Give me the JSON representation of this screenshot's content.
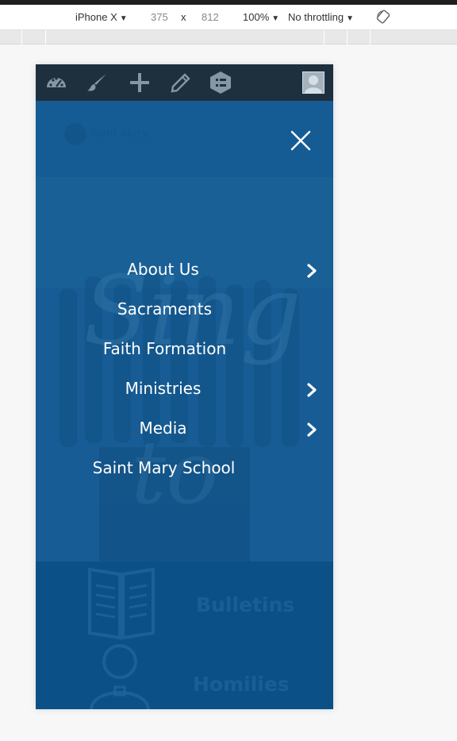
{
  "devtools": {
    "device": "iPhone X",
    "width": "375",
    "times": "x",
    "height": "812",
    "zoom": "100%",
    "throttling": "No throttling",
    "rotate_icon": "rotate-icon"
  },
  "adminbar": {
    "icons": [
      "dashboard-icon",
      "customize-brush-icon",
      "new-plus-icon",
      "edit-pencil-icon",
      "menu-list-icon",
      "user-avatar-icon"
    ]
  },
  "header": {
    "logo_text": "Saint Mary",
    "close_icon": "close-icon"
  },
  "menu": {
    "items": [
      {
        "label": "About Us",
        "has_submenu": true
      },
      {
        "label": "Sacraments",
        "has_submenu": false
      },
      {
        "label": "Faith Formation",
        "has_submenu": false
      },
      {
        "label": "Ministries",
        "has_submenu": true
      },
      {
        "label": "Media",
        "has_submenu": true
      },
      {
        "label": "Saint Mary School",
        "has_submenu": false
      }
    ]
  },
  "background_sections": {
    "bulletins": "Bulletins",
    "homilies": "Homilies"
  },
  "colors": {
    "primary": "#0d5a94",
    "adminbar": "#23282d",
    "menu_text": "#ffffff"
  }
}
